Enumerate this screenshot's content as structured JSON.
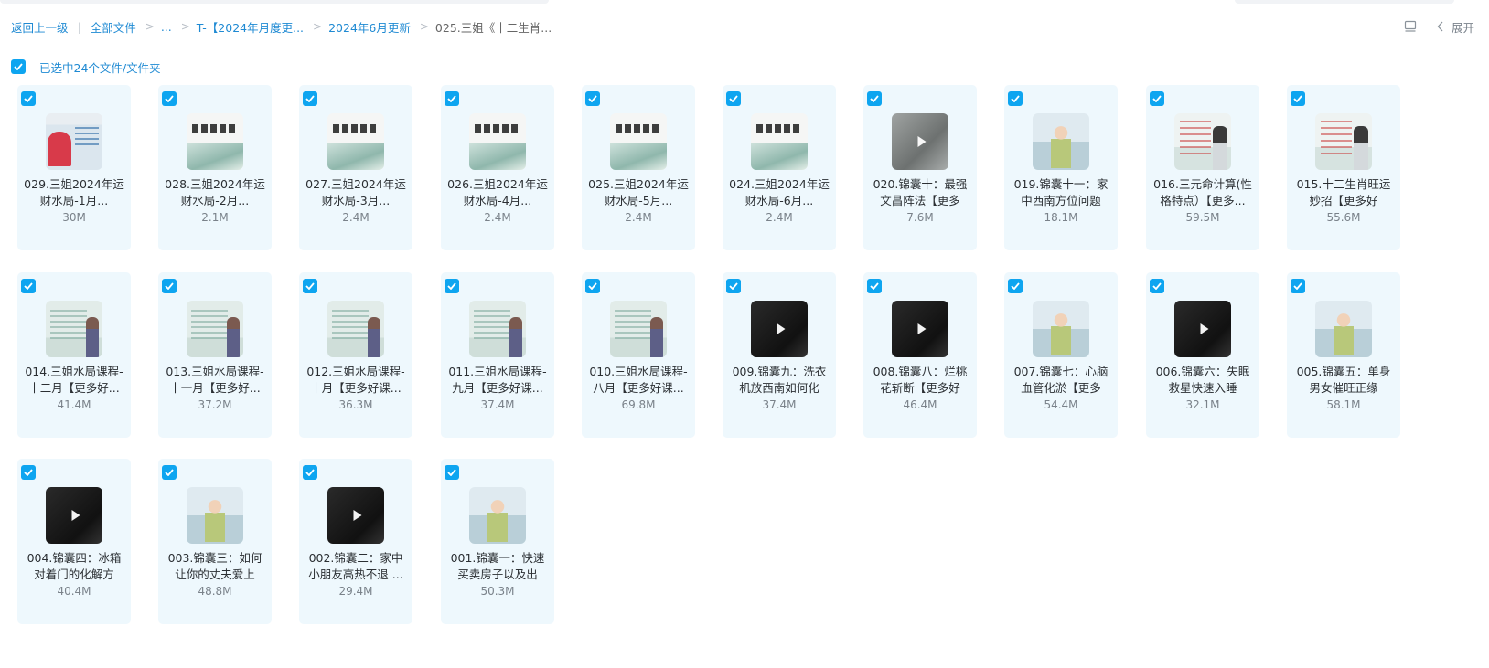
{
  "breadcrumb": {
    "back_label": "返回上一级",
    "bar": "|",
    "items": [
      {
        "label": "全部文件",
        "type": "link"
      },
      {
        "label": "...",
        "type": "link"
      },
      {
        "label": "T-【2024年月度更...",
        "type": "link"
      },
      {
        "label": "2024年6月更新",
        "type": "link"
      },
      {
        "label": "025.三姐《十二生肖...",
        "type": "current"
      }
    ],
    "separator": ">"
  },
  "toolbar": {
    "view_icon": "list-view-icon",
    "collapse_icon": "chevron-left-icon",
    "expand_label": "展开"
  },
  "selection": {
    "label": "已选中24个文件/文件夹",
    "checked": true
  },
  "colors": {
    "accent": "#0ea5f0",
    "link": "#1f8ad3",
    "card_bg": "#eef8fd"
  },
  "files": [
    {
      "name": "029.三姐2024年运财水局-1月...",
      "size": "30M",
      "thumb": "red",
      "play": false
    },
    {
      "name": "028.三姐2024年运财水局-2月...",
      "size": "2.1M",
      "thumb": "ink",
      "play": false
    },
    {
      "name": "027.三姐2024年运财水局-3月...",
      "size": "2.4M",
      "thumb": "ink",
      "play": false
    },
    {
      "name": "026.三姐2024年运财水局-4月...",
      "size": "2.4M",
      "thumb": "ink",
      "play": false
    },
    {
      "name": "025.三姐2024年运财水局-5月...",
      "size": "2.4M",
      "thumb": "ink",
      "play": false
    },
    {
      "name": "024.三姐2024年运财水局-6月...",
      "size": "2.4M",
      "thumb": "ink",
      "play": false
    },
    {
      "name": "020.锦囊十：最强文昌阵法【更多",
      "size": "7.6M",
      "thumb": "gray",
      "play": true
    },
    {
      "name": "019.锦囊十一：家中西南方位问题",
      "size": "18.1M",
      "thumb": "lady",
      "play": true
    },
    {
      "name": "016.三元命计算(性格特点）【更多...",
      "size": "59.5M",
      "thumb": "wall",
      "play": false
    },
    {
      "name": "015.十二生肖旺运妙招【更多好",
      "size": "55.6M",
      "thumb": "wall",
      "play": false
    },
    {
      "name": "014.三姐水局课程-十二月【更多好...",
      "size": "41.4M",
      "thumb": "board",
      "play": false
    },
    {
      "name": "013.三姐水局课程-十一月【更多好...",
      "size": "37.2M",
      "thumb": "board",
      "play": false
    },
    {
      "name": "012.三姐水局课程-十月【更多好课...",
      "size": "36.3M",
      "thumb": "board",
      "play": false
    },
    {
      "name": "011.三姐水局课程-九月【更多好课...",
      "size": "37.4M",
      "thumb": "board",
      "play": false
    },
    {
      "name": "010.三姐水局课程-八月【更多好课...",
      "size": "69.8M",
      "thumb": "board",
      "play": false
    },
    {
      "name": "009.锦囊九：洗衣机放西南如何化",
      "size": "37.4M",
      "thumb": "dark",
      "play": true
    },
    {
      "name": "008.锦囊八：烂桃花斩断【更多好",
      "size": "46.4M",
      "thumb": "dark",
      "play": true
    },
    {
      "name": "007.锦囊七：心脑血管化淤【更多",
      "size": "54.4M",
      "thumb": "lady",
      "play": true
    },
    {
      "name": "006.锦囊六：失眠救星快速入睡",
      "size": "32.1M",
      "thumb": "dark",
      "play": true
    },
    {
      "name": "005.锦囊五：单身男女催旺正缘",
      "size": "58.1M",
      "thumb": "lady",
      "play": true
    },
    {
      "name": "004.锦囊四：冰箱对着门的化解方",
      "size": "40.4M",
      "thumb": "dark",
      "play": true
    },
    {
      "name": "003.锦囊三：如何让你的丈夫爱上",
      "size": "48.8M",
      "thumb": "lady",
      "play": true
    },
    {
      "name": "002.锦囊二：家中小朋友高热不退 ...",
      "size": "29.4M",
      "thumb": "dark",
      "play": true
    },
    {
      "name": "001.锦囊一：快速买卖房子以及出",
      "size": "50.3M",
      "thumb": "lady",
      "play": true
    }
  ]
}
